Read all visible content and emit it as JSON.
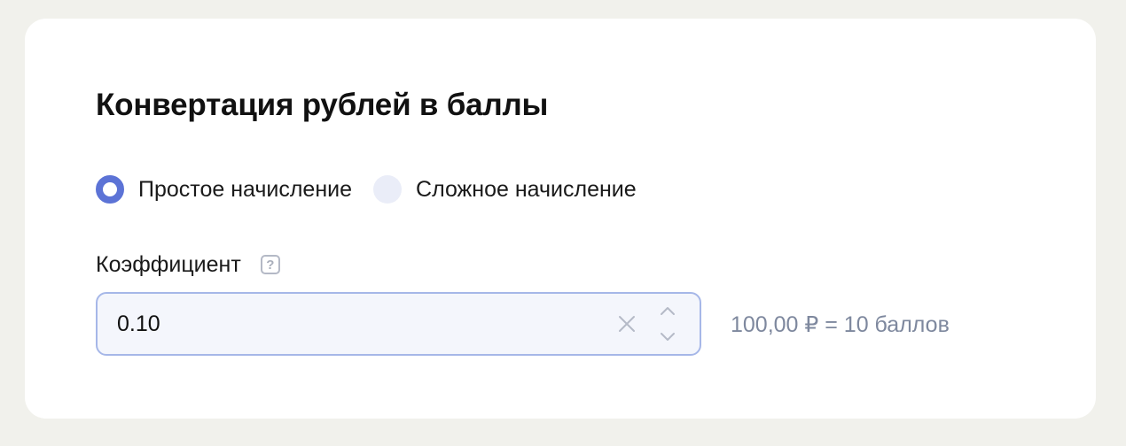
{
  "section": {
    "title": "Конвертация рублей в баллы"
  },
  "accrual_mode": {
    "options": [
      {
        "label": "Простое начисление",
        "selected": true
      },
      {
        "label": "Сложное начисление",
        "selected": false
      }
    ]
  },
  "coefficient": {
    "label": "Коэффициент",
    "help_glyph": "?",
    "value": "0.10",
    "conversion_preview": "100,00 ₽ = 10 баллов"
  },
  "colors": {
    "page_background": "#f1f1ec",
    "card_background": "#ffffff",
    "accent": "#5c73d6",
    "radio_unchecked": "#eaedf8",
    "input_border": "#a6b7e8",
    "input_background": "#f4f6fc",
    "muted_text": "#7e889e"
  },
  "icons": {
    "help": "question-square-icon",
    "clear": "close-icon",
    "increment": "chevron-up-icon",
    "decrement": "chevron-down-icon"
  }
}
